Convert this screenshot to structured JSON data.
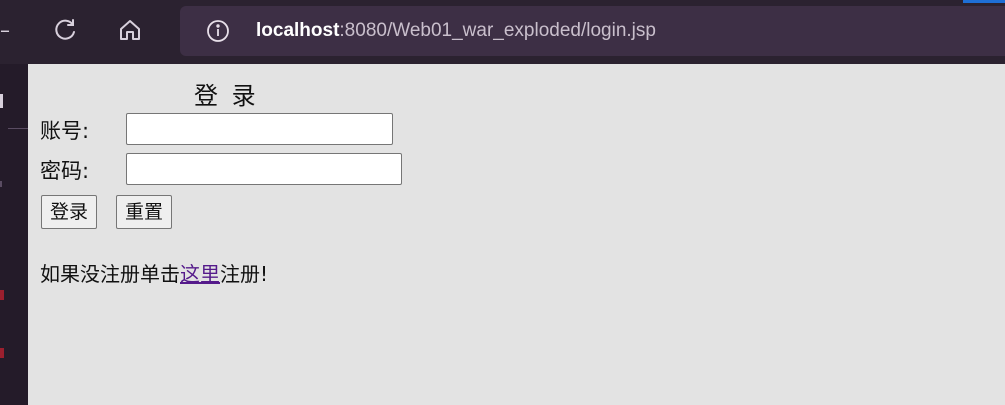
{
  "browser": {
    "url_host": "localhost",
    "url_rest": ":8080/Web01_war_exploded/login.jsp",
    "icons": [
      "refresh-icon",
      "home-icon",
      "info-icon"
    ]
  },
  "form": {
    "title": "登 录",
    "username_label": "账号:",
    "password_label": "密码:",
    "username_value": "",
    "password_value": "",
    "login_button": "登录",
    "reset_button": "重置"
  },
  "register_note": {
    "prefix": "如果没注册单击",
    "link": "这里",
    "suffix": "注册!"
  },
  "colors": {
    "chrome_bg": "#2b2230",
    "address_bg": "#3d2f45",
    "page_bg": "#e3e3e3",
    "link_visited": "#551a8b"
  }
}
